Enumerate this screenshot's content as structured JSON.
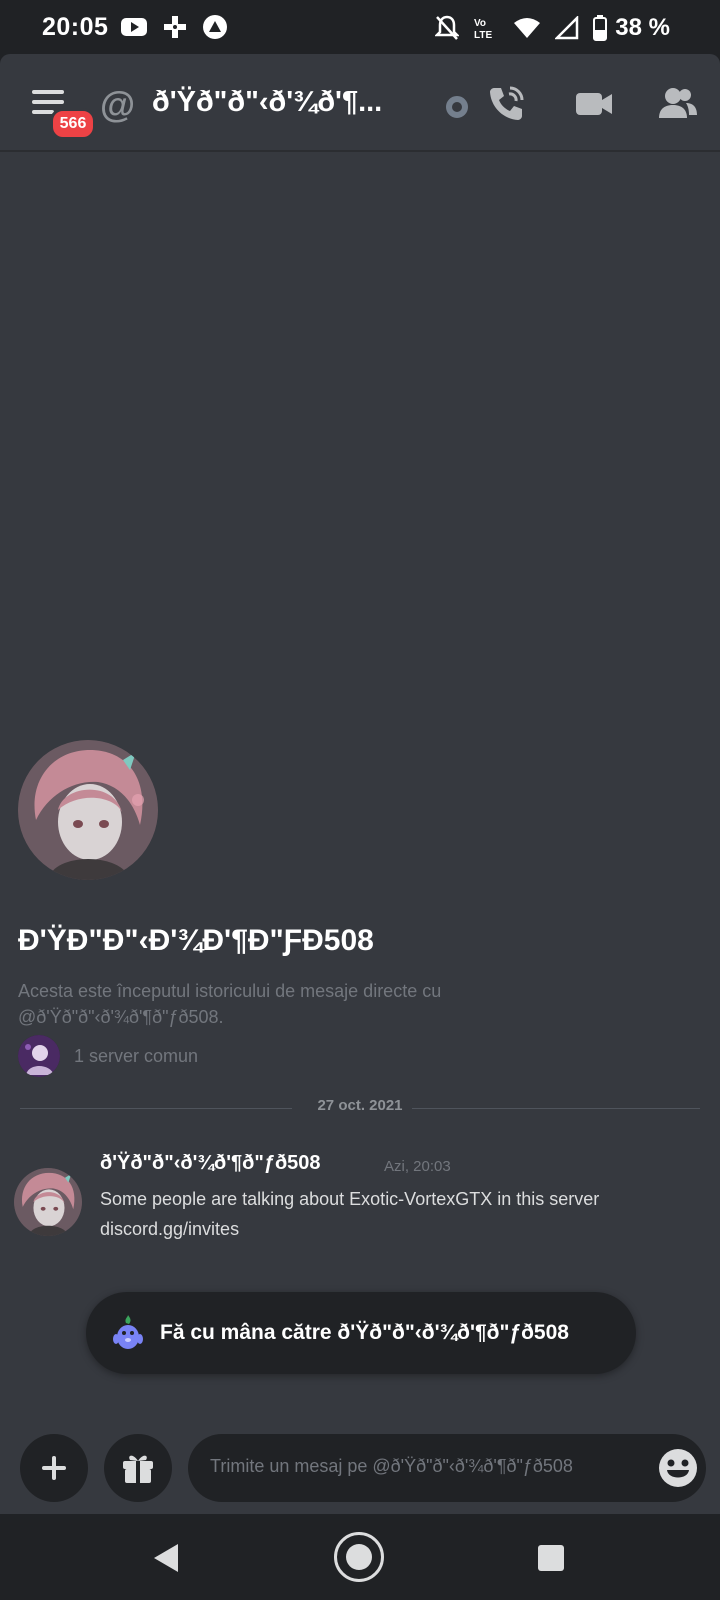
{
  "status_bar": {
    "time": "20:05",
    "battery_percent": "38 %",
    "left_icons": [
      "youtube-icon",
      "game-controller-icon",
      "vpn-icon"
    ],
    "right_icons": [
      "bell-off-icon",
      "volte-icon",
      "wifi-icon",
      "signal-icon",
      "battery-icon"
    ]
  },
  "header": {
    "notification_count": "566",
    "channel_name": "ð'Ÿð\"ð\"‹ð'¾ð'¶...",
    "icons": [
      "menu-icon",
      "at-icon",
      "status-dot",
      "voice-call-icon",
      "video-call-icon",
      "members-icon"
    ]
  },
  "intro": {
    "display_name": "Ð'ŸÐ\"Ð\"‹Ð'¾Ð'¶Ð\"ƑÐ508",
    "description": "Acesta este începutul istoricului de mesaje directe cu @ð'Ÿð\"ð\"‹ð'¾ð'¶ð\"ƒð508.",
    "mutual_servers": "1 server comun"
  },
  "divider": {
    "date": "27 oct. 2021"
  },
  "message": {
    "author": "ð'Ÿð\"ð\"‹ð'¾ð'¶ð\"ƒð508",
    "timestamp": "Azi, 20:03",
    "line1": "Some people are talking about Exotic-VortexGTX in this server",
    "line2": "discord.gg/invites"
  },
  "wave": {
    "label": "Fă cu mâna către ð'Ÿð\"ð\"‹ð'¾ð'¶ð\"ƒð508"
  },
  "composer": {
    "placeholder": "Trimite un mesaj pe @ð'Ÿð\"ð\"‹ð'¾ð'¶ð\"ƒð508",
    "icons": [
      "plus-icon",
      "gift-icon",
      "emoji-icon"
    ]
  },
  "nav": {
    "icons": [
      "back-icon",
      "home-icon",
      "recents-icon"
    ]
  },
  "colors": {
    "background": "#36393f",
    "dark": "#202225",
    "badge": "#ed4245",
    "muted_text": "#72767d",
    "white": "#ffffff"
  }
}
